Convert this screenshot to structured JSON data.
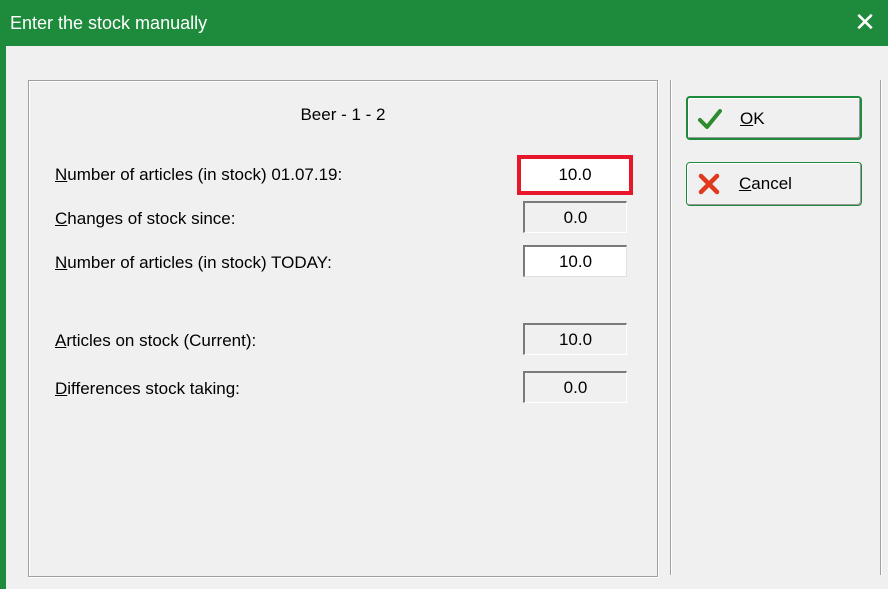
{
  "window": {
    "title": "Enter the stock manually",
    "close_label": "✕"
  },
  "panel": {
    "title": "Beer - 1 - 2",
    "rows": [
      {
        "label_first": "N",
        "label_rest": "umber of articles (in stock) 01.07.19:",
        "value": "10.0"
      },
      {
        "label_first": "C",
        "label_rest": "hanges of stock since:",
        "value": "0.0"
      },
      {
        "label_first": "N",
        "label_rest": "umber of articles (in stock) TODAY:",
        "value": "10.0"
      },
      {
        "label_first": "A",
        "label_rest": "rticles on stock (Current):",
        "value": "10.0"
      },
      {
        "label_first": "D",
        "label_rest": "ifferences stock taking:",
        "value": "0.0"
      }
    ]
  },
  "buttons": {
    "ok": {
      "label_first": "O",
      "label_rest": "K",
      "icon": "checkmark-icon",
      "icon_color": "#2e8b2e"
    },
    "cancel": {
      "label_first": "C",
      "label_rest": "ancel",
      "icon": "x-cross-icon",
      "icon_color": "#e03a1e"
    }
  },
  "colors": {
    "titlebar": "#1e8a3b",
    "highlight_border": "#e8162b"
  }
}
